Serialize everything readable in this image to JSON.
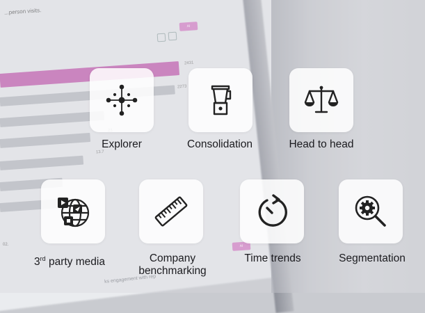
{
  "background": {
    "caption": "...person visits.",
    "bar_values": [
      "2431",
      "2273",
      "23",
      "13.7"
    ],
    "pill_text": "AI",
    "axis_label": "02.",
    "footer_text": "ks engagement with rep"
  },
  "features": [
    {
      "id": "explorer",
      "label": "Explorer",
      "icon": "explorer-crosshair-icon"
    },
    {
      "id": "consolidation",
      "label": "Consolidation",
      "icon": "blender-icon"
    },
    {
      "id": "head-to-head",
      "label": "Head to head",
      "icon": "balance-scale-icon"
    },
    {
      "id": "third-party-media",
      "label_pre": "3",
      "label_sup": "rd",
      "label_post": " party media",
      "icon": "global-media-icon"
    },
    {
      "id": "company-benchmarking",
      "label_line1": "Company",
      "label_line2": "benchmarking",
      "icon": "ruler-icon"
    },
    {
      "id": "time-trends",
      "label": "Time trends",
      "icon": "timer-icon"
    },
    {
      "id": "segmentation",
      "label": "Segmentation",
      "icon": "magnifier-gear-icon"
    }
  ]
}
